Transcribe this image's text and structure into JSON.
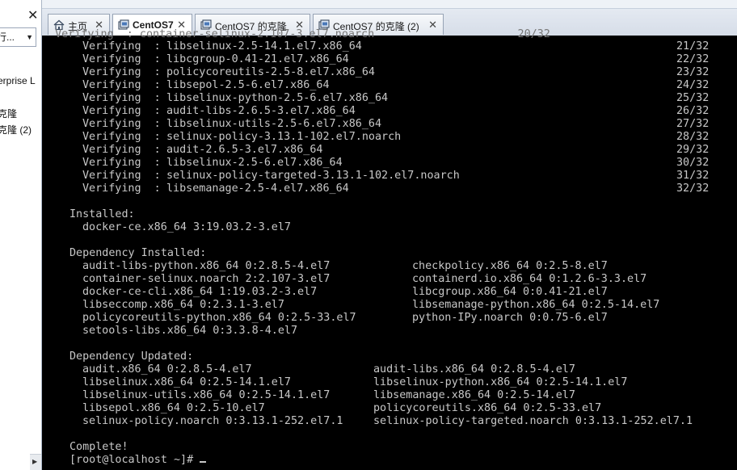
{
  "sidebar": {
    "close_glyph": "✕",
    "dropdown_text": "行...",
    "items": [
      "erprise L",
      "克隆",
      "克隆 (2)"
    ]
  },
  "tabs": [
    {
      "label": "主页",
      "icon": "home-icon",
      "active": false
    },
    {
      "label": "CentOS7",
      "icon": "vm-icon",
      "active": true
    },
    {
      "label": "CentOS7 的克隆",
      "icon": "vm-icon",
      "active": false
    },
    {
      "label": "CentOS7 的克隆 (2)",
      "icon": "vm-icon",
      "active": false
    }
  ],
  "tab_close_glyph": "✕",
  "terminal": {
    "partial_top": "  Verifying  : container-selinux-2.107-3.el7.noarch                      20/32",
    "verifying": [
      {
        "name": "libselinux-2.5-14.1.el7.x86_64",
        "count": "21/32"
      },
      {
        "name": "libcgroup-0.41-21.el7.x86_64",
        "count": "22/32"
      },
      {
        "name": "policycoreutils-2.5-8.el7.x86_64",
        "count": "23/32"
      },
      {
        "name": "libsepol-2.5-6.el7.x86_64",
        "count": "24/32"
      },
      {
        "name": "libselinux-python-2.5-6.el7.x86_64",
        "count": "25/32"
      },
      {
        "name": "audit-libs-2.6.5-3.el7.x86_64",
        "count": "26/32"
      },
      {
        "name": "libselinux-utils-2.5-6.el7.x86_64",
        "count": "27/32"
      },
      {
        "name": "selinux-policy-3.13.1-102.el7.noarch",
        "count": "28/32"
      },
      {
        "name": "audit-2.6.5-3.el7.x86_64",
        "count": "29/32"
      },
      {
        "name": "libselinux-2.5-6.el7.x86_64",
        "count": "30/32"
      },
      {
        "name": "selinux-policy-targeted-3.13.1-102.el7.noarch",
        "count": "31/32"
      },
      {
        "name": "libsemanage-2.5-4.el7.x86_64",
        "count": "32/32"
      }
    ],
    "verifying_label": "Verifying  :",
    "installed_header": "Installed:",
    "installed": [
      "docker-ce.x86_64 3:19.03.2-3.el7"
    ],
    "dep_installed_header": "Dependency Installed:",
    "dep_installed": [
      [
        "audit-libs-python.x86_64 0:2.8.5-4.el7",
        "checkpolicy.x86_64 0:2.5-8.el7"
      ],
      [
        "container-selinux.noarch 2:2.107-3.el7",
        "containerd.io.x86_64 0:1.2.6-3.3.el7"
      ],
      [
        "docker-ce-cli.x86_64 1:19.03.2-3.el7",
        "libcgroup.x86_64 0:0.41-21.el7"
      ],
      [
        "libseccomp.x86_64 0:2.3.1-3.el7",
        "libsemanage-python.x86_64 0:2.5-14.el7"
      ],
      [
        "policycoreutils-python.x86_64 0:2.5-33.el7",
        "python-IPy.noarch 0:0.75-6.el7"
      ],
      [
        "setools-libs.x86_64 0:3.3.8-4.el7",
        ""
      ]
    ],
    "dep_updated_header": "Dependency Updated:",
    "dep_updated": [
      [
        "audit.x86_64 0:2.8.5-4.el7",
        "audit-libs.x86_64 0:2.8.5-4.el7"
      ],
      [
        "libselinux.x86_64 0:2.5-14.1.el7",
        "libselinux-python.x86_64 0:2.5-14.1.el7"
      ],
      [
        "libselinux-utils.x86_64 0:2.5-14.1.el7",
        "libsemanage.x86_64 0:2.5-14.el7"
      ],
      [
        "libsepol.x86_64 0:2.5-10.el7",
        "policycoreutils.x86_64 0:2.5-33.el7"
      ],
      [
        "selinux-policy.noarch 0:3.13.1-252.el7.1",
        "selinux-policy-targeted.noarch 0:3.13.1-252.el7.1"
      ]
    ],
    "complete": "Complete!",
    "prompt": "[root@localhost ~]# "
  }
}
